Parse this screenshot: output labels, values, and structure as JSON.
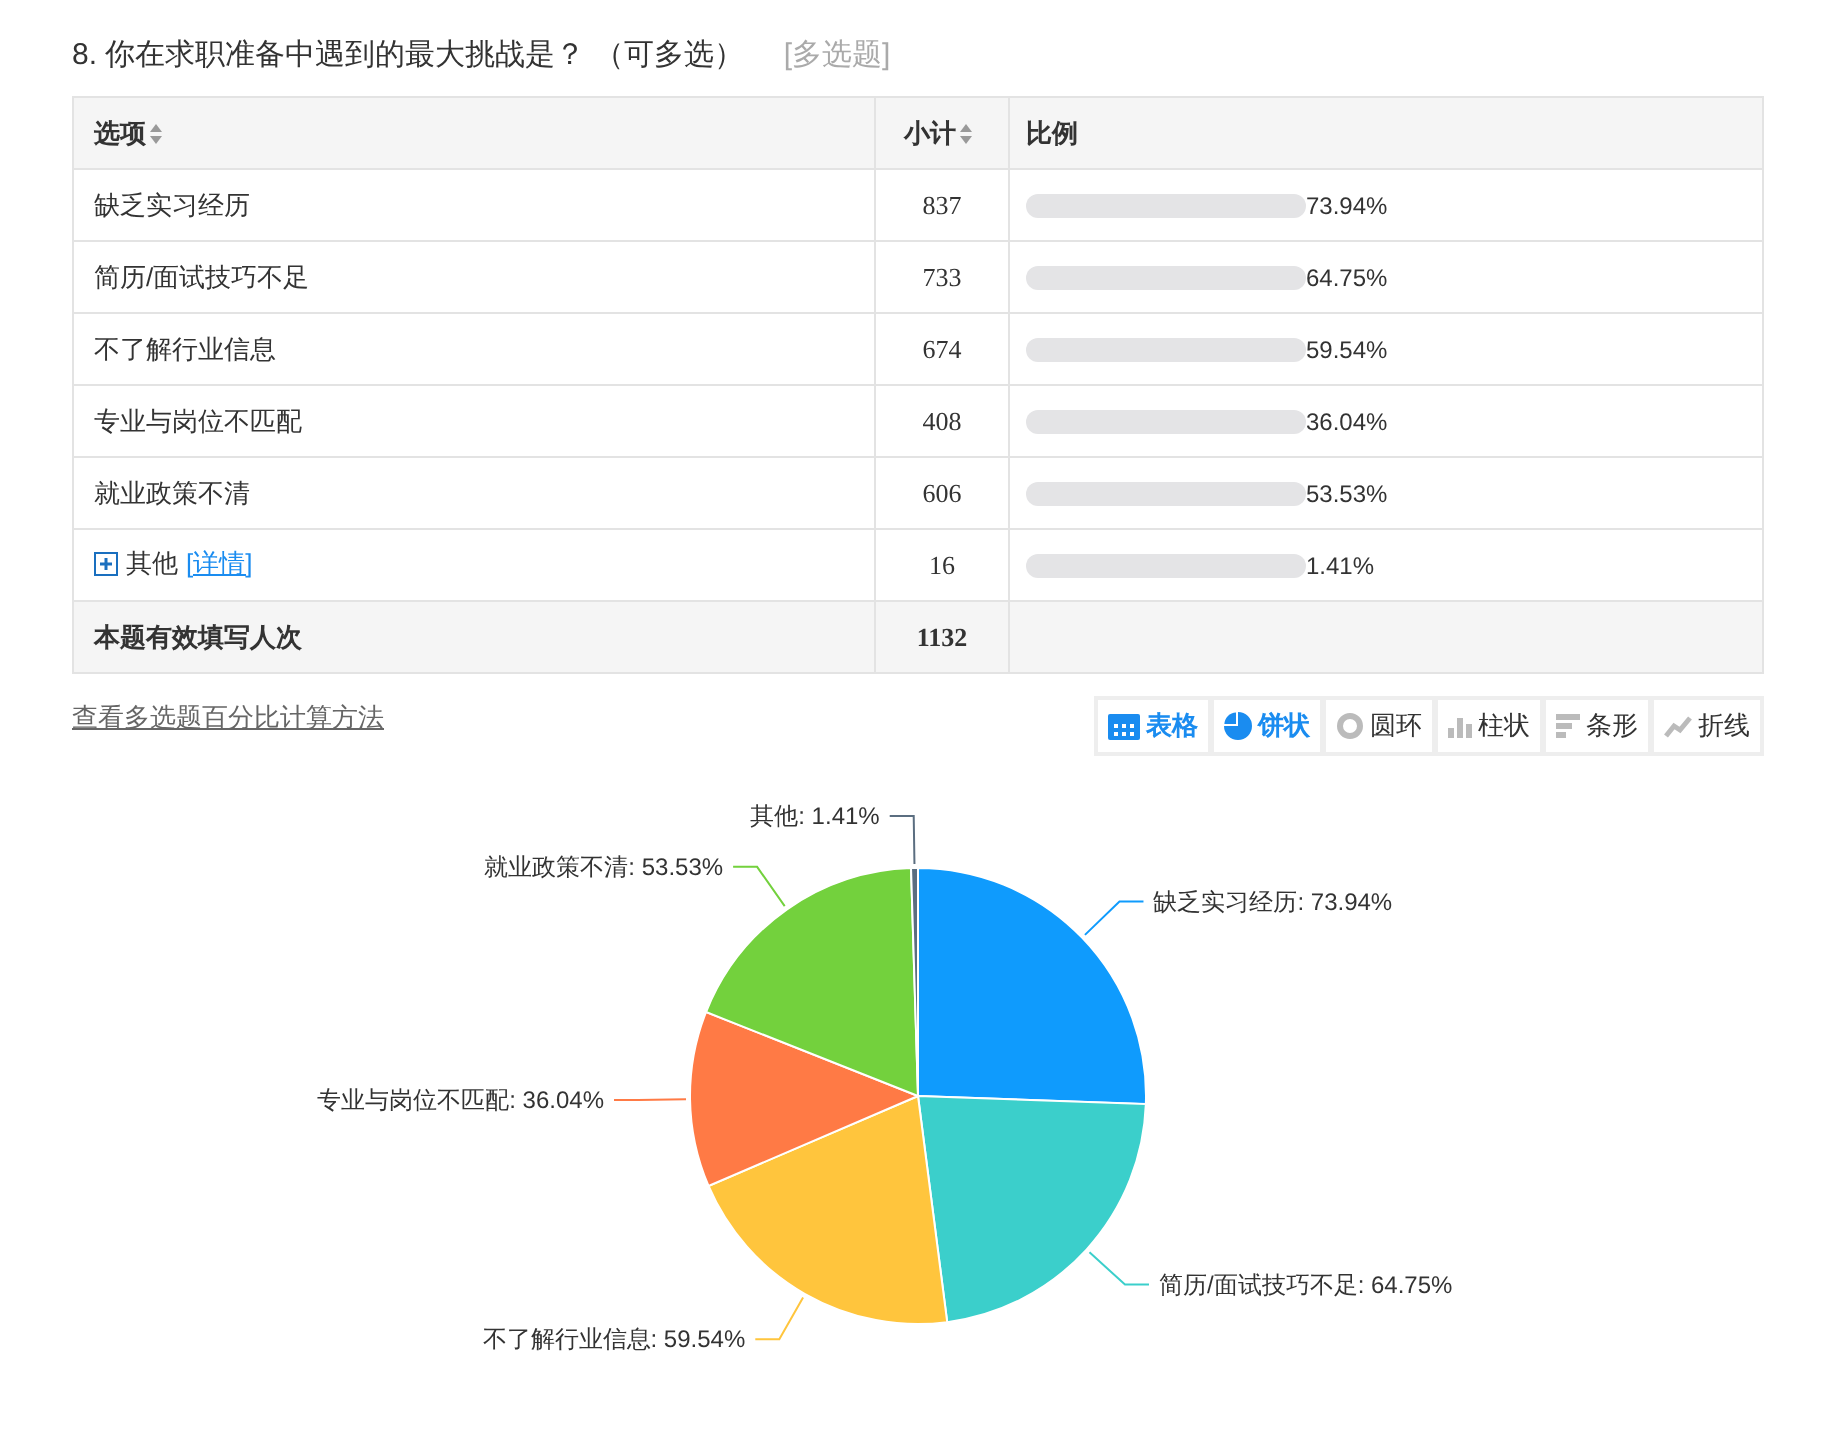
{
  "question": {
    "title": "8. 你在求职准备中遇到的最大挑战是？ （可多选）",
    "type_tag": "[多选题]"
  },
  "table": {
    "columns": [
      {
        "label": "选项",
        "sortable": true
      },
      {
        "label": "小计",
        "sortable": true
      },
      {
        "label": "比例",
        "sortable": false
      }
    ],
    "rows": [
      {
        "option": "缺乏实习经历",
        "count": "837",
        "percent": "73.94%"
      },
      {
        "option": "简历/面试技巧不足",
        "count": "733",
        "percent": "64.75%"
      },
      {
        "option": "不了解行业信息",
        "count": "674",
        "percent": "59.54%"
      },
      {
        "option": "专业与岗位不匹配",
        "count": "408",
        "percent": "36.04%"
      },
      {
        "option": "就业政策不清",
        "count": "606",
        "percent": "53.53%"
      },
      {
        "option": "其他",
        "count": "16",
        "percent": "1.41%",
        "detail_link": "[详情]"
      }
    ],
    "total": {
      "label": "本题有效填写人次",
      "count": "1132"
    }
  },
  "method_link": "查看多选题百分比计算方法",
  "view_buttons": [
    {
      "label": "表格",
      "kind": "table",
      "selected": true
    },
    {
      "label": "饼状",
      "kind": "pie",
      "selected": true
    },
    {
      "label": "圆环",
      "kind": "ring",
      "selected": false
    },
    {
      "label": "柱状",
      "kind": "column",
      "selected": false
    },
    {
      "label": "条形",
      "kind": "bar",
      "selected": false
    },
    {
      "label": "折线",
      "kind": "line",
      "selected": false
    }
  ],
  "chart_data": {
    "type": "pie",
    "values": [
      73.94,
      64.75,
      59.54,
      36.04,
      53.53,
      1.41
    ],
    "colors": [
      "#0f9bfd",
      "#3bcfcb",
      "#ffc53d",
      "#ff7a45",
      "#73d13d",
      "#5b6e80"
    ],
    "value_labels": [
      "缺乏实习经历: 73.94%",
      "简历/面试技巧不足: 64.75%",
      "不了解行业信息: 59.54%",
      "专业与岗位不匹配: 36.04%",
      "就业政策不清: 53.53%",
      "其他: 1.41%"
    ]
  }
}
